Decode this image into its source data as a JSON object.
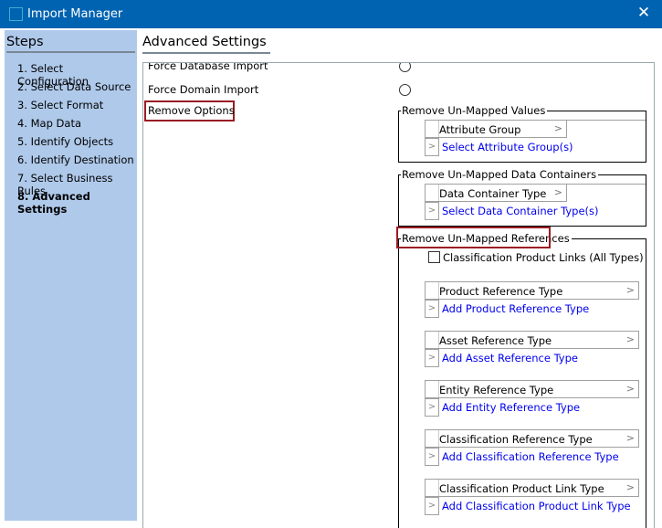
{
  "window": {
    "title": "Import Manager",
    "close": "✕"
  },
  "steps": {
    "title": "Steps",
    "items": [
      "1. Select Configuration",
      "2. Select Data Source",
      "3. Select Format",
      "4. Map Data",
      "5. Identify Objects",
      "6. Identify Destination",
      "7. Select Business Rules",
      "8. Advanced Settings"
    ],
    "active_index": 7
  },
  "main": {
    "title": "Advanced Settings",
    "force_db": "Force Database Import",
    "force_domain": "Force Domain Import",
    "remove_options": "Remove Options",
    "values_group": {
      "label": "Remove Un-Mapped Values",
      "header": "Attribute Group",
      "link": "Select Attribute Group(s)"
    },
    "containers_group": {
      "label": "Remove Un-Mapped Data Containers",
      "header": "Data Container Type",
      "link": "Select Data Container Type(s)"
    },
    "refs_group": {
      "label": "Remove Un-Mapped References",
      "checkbox": "Classification Product Links (All Types)",
      "checked": false,
      "tables": [
        {
          "header": "Product Reference Type",
          "link": "Add Product Reference Type"
        },
        {
          "header": "Asset Reference Type",
          "link": "Add Asset Reference Type"
        },
        {
          "header": "Entity Reference Type",
          "link": "Add Entity Reference Type"
        },
        {
          "header": "Classification Reference Type",
          "link": "Add Classification Reference Type"
        },
        {
          "header": "Classification Product Link Type",
          "link": "Add Classification Product Link Type"
        }
      ]
    }
  }
}
